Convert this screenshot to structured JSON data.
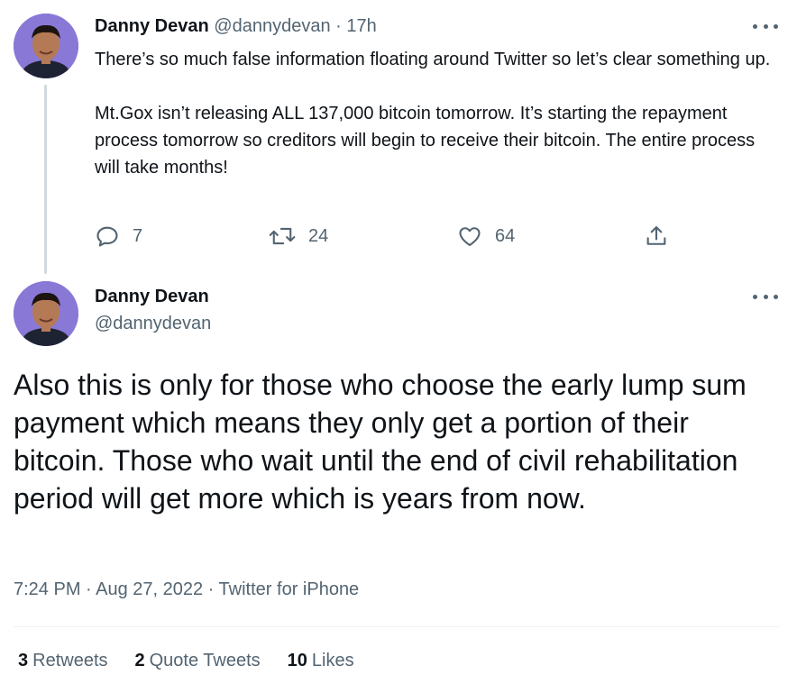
{
  "reply_tweet": {
    "author_name": "Danny Devan",
    "handle_time": "@dannydevan · 17h",
    "paragraph_1": "There’s so much false information floating around Twitter so let’s clear something up.",
    "paragraph_2": "Mt.Gox isn’t releasing ALL 137,000 bitcoin tomorrow. It’s starting the repayment process tomorrow so creditors will begin to receive their bitcoin. The entire process will take months!",
    "actions": {
      "reply_count": "7",
      "retweet_count": "24",
      "like_count": "64"
    },
    "icons": [
      "reply-icon",
      "retweet-icon",
      "like-icon",
      "share-icon",
      "more-icon"
    ]
  },
  "main_tweet": {
    "author_name": "Danny Devan",
    "handle": "@dannydevan",
    "text": "Also this is only for those who choose the early lump sum payment which means they only get a portion of their bitcoin. Those who wait until the end of civil rehabilitation period will get more which is years from now.",
    "meta": "7:24 PM · Aug 27, 2022 · Twitter for iPhone",
    "stats": {
      "retweets_num": "3",
      "retweets_label": "Retweets",
      "quotes_num": "2",
      "quotes_label": "Quote Tweets",
      "likes_num": "10",
      "likes_label": "Likes"
    }
  },
  "colors": {
    "text": "#0f1419",
    "muted": "#536471",
    "thread_line": "#cfd9de",
    "avatar_bg": "#8a78d6"
  }
}
